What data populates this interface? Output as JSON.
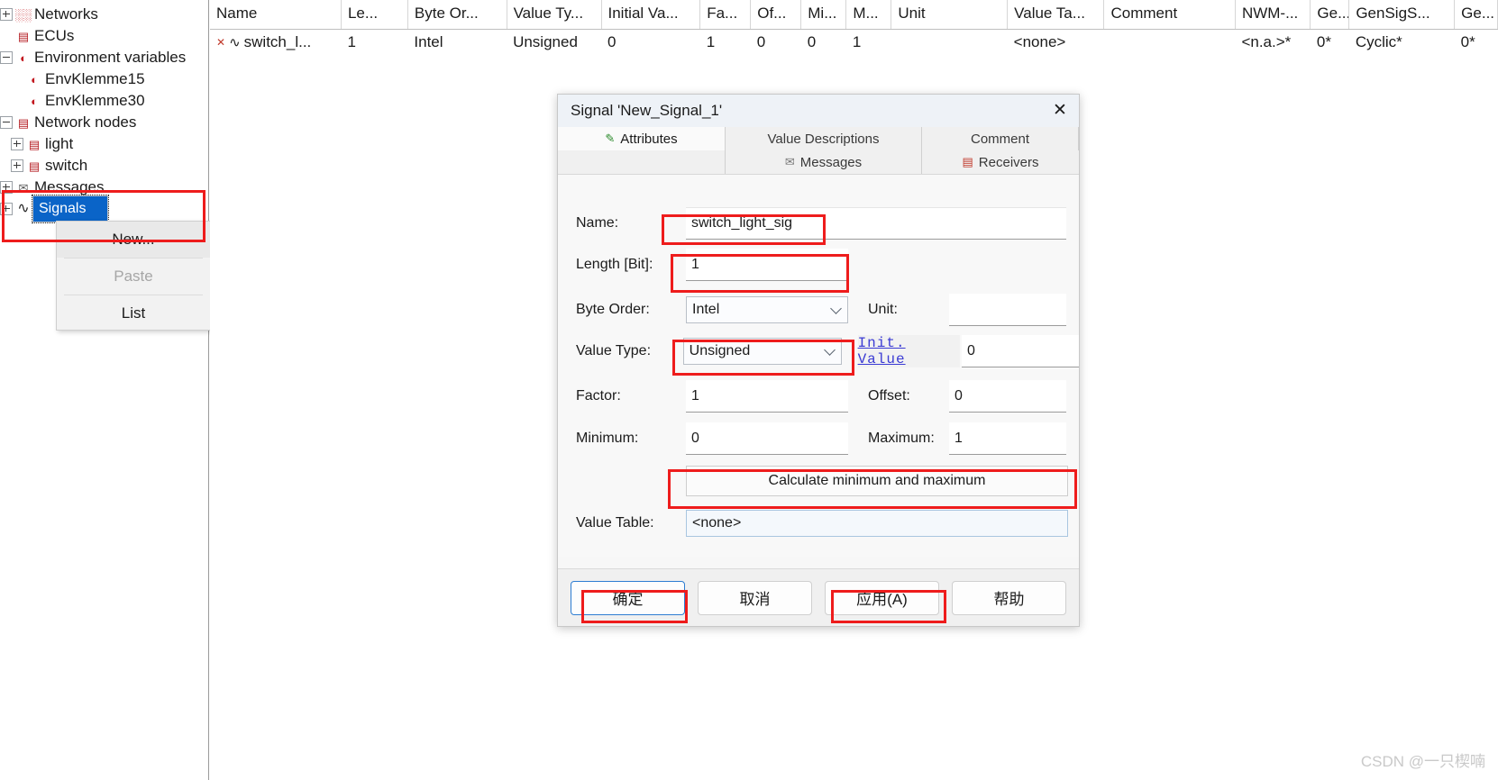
{
  "tree": {
    "items": [
      {
        "label": "Networks",
        "icon": "network-icon",
        "icon_glyph": "▓",
        "toggle": "plus",
        "indent": 0
      },
      {
        "label": "ECUs",
        "icon": "ecu-icon",
        "icon_glyph": "☗",
        "toggle": "none",
        "indent": 0
      },
      {
        "label": "Environment variables",
        "icon": "env-variable-icon",
        "icon_glyph": "◠",
        "toggle": "minus",
        "indent": 0
      },
      {
        "label": "EnvKlemme15",
        "icon": "env-variable-icon",
        "icon_glyph": "◠",
        "toggle": "none",
        "indent": 1
      },
      {
        "label": "EnvKlemme30",
        "icon": "env-variable-icon",
        "icon_glyph": "◠",
        "toggle": "none",
        "indent": 1
      },
      {
        "label": "Network nodes",
        "icon": "network-node-icon",
        "icon_glyph": "☗",
        "toggle": "minus",
        "indent": 0
      },
      {
        "label": "light",
        "icon": "network-node-icon",
        "icon_glyph": "☗",
        "toggle": "plus",
        "indent": 1
      },
      {
        "label": "switch",
        "icon": "network-node-icon",
        "icon_glyph": "☗",
        "toggle": "plus",
        "indent": 1
      },
      {
        "label": "Messages",
        "icon": "message-icon",
        "icon_glyph": "✉",
        "toggle": "plus",
        "indent": 0
      },
      {
        "label": "Signals",
        "icon": "signal-icon",
        "icon_glyph": "∿",
        "toggle": "plus",
        "indent": 0,
        "selected": true
      }
    ]
  },
  "context_menu": {
    "items": [
      {
        "label": "New...",
        "enabled": true,
        "highlighted": true
      },
      {
        "label": "Paste",
        "enabled": false,
        "highlighted": false
      },
      {
        "label": "List",
        "enabled": true,
        "highlighted": false
      }
    ]
  },
  "table": {
    "columns": [
      "Name",
      "Le...",
      "Byte Or...",
      "Value Ty...",
      "Initial Va...",
      "Fa...",
      "Of...",
      "Mi...",
      "M...",
      "Unit",
      "Value Ta...",
      "Comment",
      "NWM-...",
      "Ge...",
      "GenSigS...",
      "Ge..."
    ],
    "rows": [
      {
        "name": "switch_l...",
        "length": "1",
        "byte_order": "Intel",
        "value_type": "Unsigned",
        "initial_value": "0",
        "factor": "1",
        "offset": "0",
        "minimum": "0",
        "maximum": "1",
        "unit": "",
        "value_table": "<none>",
        "comment": "",
        "nwm": "<n.a.>*",
        "ge1": "0*",
        "gensigs": "Cyclic*",
        "ge2": "0*"
      }
    ]
  },
  "dialog": {
    "title": "Signal 'New_Signal_1'",
    "close_label": "✕",
    "tabs_row1": [
      {
        "label": "Attributes",
        "icon": "attributes-icon",
        "active": true
      },
      {
        "label": "Value Descriptions",
        "icon": "",
        "active": false
      },
      {
        "label": "Comment",
        "icon": "",
        "active": false
      }
    ],
    "tabs_row2": [
      {
        "label": "Messages",
        "icon": "messages-icon",
        "active": false
      },
      {
        "label": "Receivers",
        "icon": "receivers-icon",
        "active": false
      }
    ],
    "fields": {
      "name_label": "Name:",
      "name_value": "switch_light_sig",
      "length_label": "Length [Bit]:",
      "length_value": "1",
      "byte_order_label": "Byte Order:",
      "byte_order_value": "Intel",
      "unit_label": "Unit:",
      "unit_value": "",
      "value_type_label": "Value Type:",
      "value_type_value": "Unsigned",
      "init_value_link": "Init. Value",
      "init_value": "0",
      "factor_label": "Factor:",
      "factor_value": "1",
      "offset_label": "Offset:",
      "offset_value": "0",
      "minimum_label": "Minimum:",
      "minimum_value": "0",
      "maximum_label": "Maximum:",
      "maximum_value": "1",
      "calc_button": "Calculate minimum and maximum",
      "value_table_label": "Value Table:",
      "value_table_value": "<none>"
    },
    "buttons": [
      {
        "label": "确定",
        "name": "ok-button",
        "default": true
      },
      {
        "label": "取消",
        "name": "cancel-button",
        "default": false
      },
      {
        "label": "应用(A)",
        "name": "apply-button",
        "default": false
      },
      {
        "label": "帮助",
        "name": "help-button",
        "default": false
      }
    ]
  },
  "watermark": "CSDN @一只楔喃",
  "colors": {
    "accent": "#0a64c8",
    "annotation": "#ee1c1c",
    "link": "#3b3bd4"
  }
}
